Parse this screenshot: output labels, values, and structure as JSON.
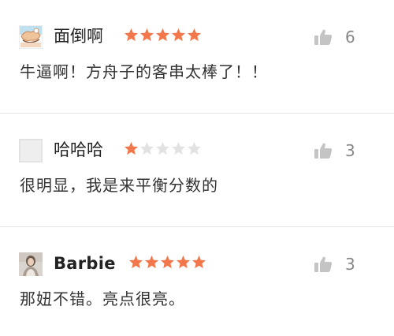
{
  "reviews": [
    {
      "username": "面倒啊",
      "rating": 5,
      "max_rating": 5,
      "likes": "6",
      "comment": "牛逼啊！方舟子的客串太棒了！！",
      "avatar": "drawing-avatar"
    },
    {
      "username": "哈哈哈",
      "rating": 1,
      "max_rating": 5,
      "likes": "3",
      "comment": "很明显，我是来平衡分数的",
      "avatar": "default-avatar"
    },
    {
      "username": "Barbie",
      "rating": 5,
      "max_rating": 5,
      "likes": "3",
      "comment": "那妞不错。亮点很亮。",
      "avatar": "photo-avatar"
    }
  ],
  "icons": {
    "star": "star-icon",
    "like": "thumbs-up-icon"
  },
  "colors": {
    "star_filled": "#f2784b",
    "star_empty": "#e2e2e2",
    "like_icon": "#c4c4c4",
    "divider": "#e3e3e3"
  }
}
